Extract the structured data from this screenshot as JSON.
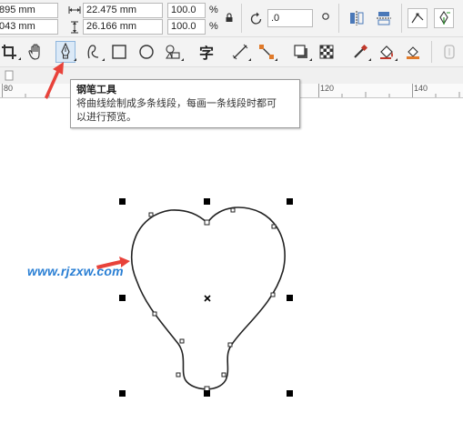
{
  "property_bar": {
    "x_value": "895 mm",
    "y_value": "043 mm",
    "width_value": "22.475 mm",
    "height_value": "26.166 mm",
    "scale_x": "100.0",
    "scale_y": "100.0",
    "percent_symbol": "%",
    "rotation_value": ".0"
  },
  "toolbox": {
    "text_tool_glyph": "字"
  },
  "ruler": {
    "labels": [
      "80",
      "120",
      "140"
    ]
  },
  "tooltip": {
    "title": "钢笔工具",
    "description_line1": "将曲线绘制成多条线段，每画一条线段时都可",
    "description_line2": "以进行预览。"
  },
  "watermark": {
    "text": "www.rjzxw.com"
  },
  "colors": {
    "accent_red": "#e8423a",
    "watermark_blue": "#2a7fd4",
    "handle_black": "#000000"
  },
  "icons": {
    "active_tool": "pen-tool-icon"
  }
}
